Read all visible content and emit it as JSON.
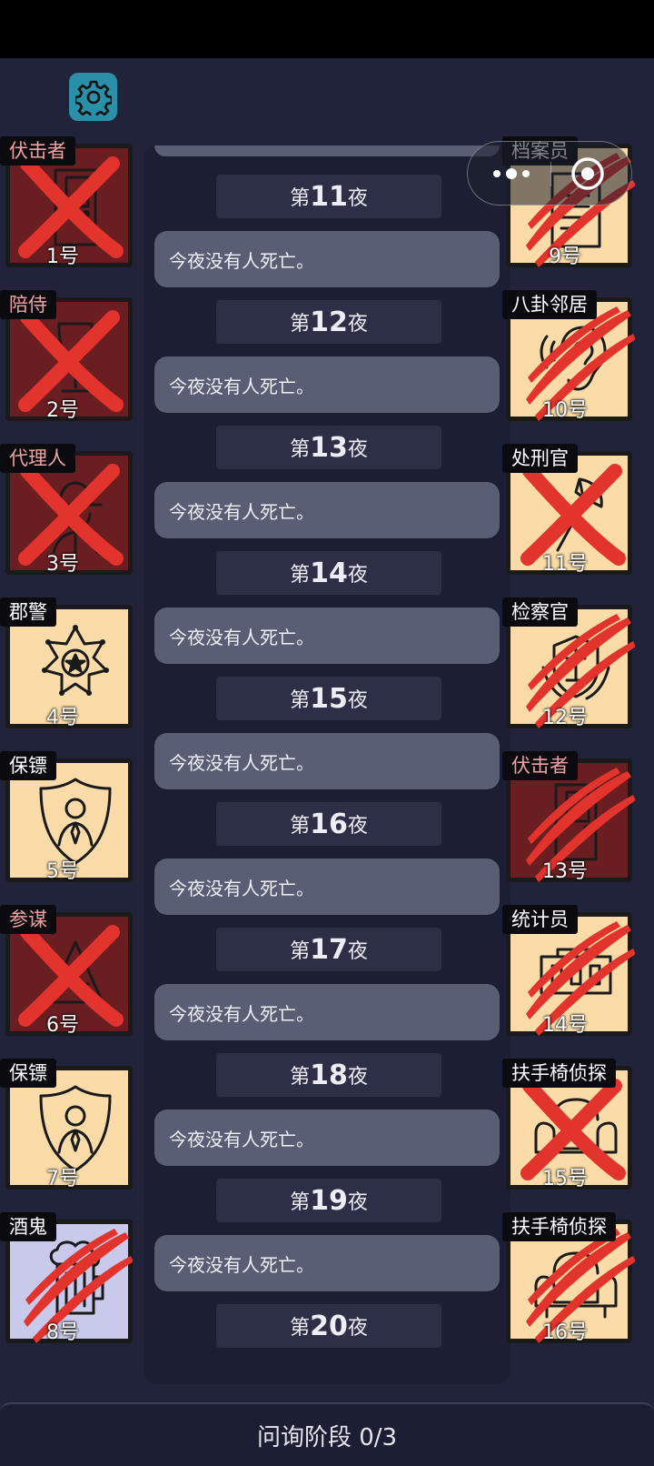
{
  "settings": {
    "icon": "gear-icon"
  },
  "capsule": {
    "more_icon": "more-dots-icon",
    "close_icon": "target-close-icon"
  },
  "log": {
    "entries": [
      {
        "night_prefix": "第",
        "night_num": "11",
        "night_suffix": "夜",
        "message": "今夜没有人死亡。"
      },
      {
        "night_prefix": "第",
        "night_num": "12",
        "night_suffix": "夜",
        "message": "今夜没有人死亡。"
      },
      {
        "night_prefix": "第",
        "night_num": "13",
        "night_suffix": "夜",
        "message": "今夜没有人死亡。"
      },
      {
        "night_prefix": "第",
        "night_num": "14",
        "night_suffix": "夜",
        "message": "今夜没有人死亡。"
      },
      {
        "night_prefix": "第",
        "night_num": "15",
        "night_suffix": "夜",
        "message": "今夜没有人死亡。"
      },
      {
        "night_prefix": "第",
        "night_num": "16",
        "night_suffix": "夜",
        "message": "今夜没有人死亡。"
      },
      {
        "night_prefix": "第",
        "night_num": "17",
        "night_suffix": "夜",
        "message": "今夜没有人死亡。"
      },
      {
        "night_prefix": "第",
        "night_num": "18",
        "night_suffix": "夜",
        "message": "今夜没有人死亡。"
      },
      {
        "night_prefix": "第",
        "night_num": "19",
        "night_suffix": "夜",
        "message": "今夜没有人死亡。"
      },
      {
        "night_prefix": "第",
        "night_num": "20",
        "night_suffix": "夜"
      }
    ]
  },
  "players_left": [
    {
      "role": "伏击者",
      "number": "1号",
      "role_color": "#f0a3a3",
      "status": "killed",
      "icon": "door-icon"
    },
    {
      "role": "陪侍",
      "number": "2号",
      "role_color": "#f0a3a3",
      "status": "killed",
      "icon": "wine-glass-icon"
    },
    {
      "role": "代理人",
      "number": "3号",
      "role_color": "#f0a3a3",
      "status": "killed",
      "icon": "agent-hat-icon"
    },
    {
      "role": "郡警",
      "number": "4号",
      "role_color": "#ffffff",
      "status": "alive",
      "icon": "sheriff-badge-icon"
    },
    {
      "role": "保镖",
      "number": "5号",
      "role_color": "#ffffff",
      "status": "alive",
      "icon": "bodyguard-shield-icon"
    },
    {
      "role": "参谋",
      "number": "6号",
      "role_color": "#f0a3a3",
      "status": "killed",
      "icon": "advisor-icon"
    },
    {
      "role": "保镖",
      "number": "7号",
      "role_color": "#ffffff",
      "status": "alive",
      "icon": "bodyguard-shield-icon"
    },
    {
      "role": "酒鬼",
      "number": "8号",
      "role_color": "#ffffff",
      "status": "clawed",
      "icon": "drunk-icon"
    }
  ],
  "players_right": [
    {
      "role": "档案员",
      "number": "9号",
      "role_color": "#ffffff",
      "status": "clawed",
      "icon": "archive-icon"
    },
    {
      "role": "八卦邻居",
      "number": "10号",
      "role_color": "#ffffff",
      "status": "clawed",
      "icon": "gossip-ear-icon"
    },
    {
      "role": "处刑官",
      "number": "11号",
      "role_color": "#ffffff",
      "status": "killed",
      "icon": "axe-icon"
    },
    {
      "role": "检察官",
      "number": "12号",
      "role_color": "#ffffff",
      "status": "clawed",
      "icon": "prosecutor-emblem-icon"
    },
    {
      "role": "伏击者",
      "number": "13号",
      "role_color": "#f0a3a3",
      "status": "clawed",
      "icon": "door-icon"
    },
    {
      "role": "统计员",
      "number": "14号",
      "role_color": "#ffffff",
      "status": "clawed",
      "icon": "counter-icon"
    },
    {
      "role": "扶手椅侦探",
      "number": "15号",
      "role_color": "#ffffff",
      "status": "killed",
      "icon": "armchair-icon"
    },
    {
      "role": "扶手椅侦探",
      "number": "16号",
      "role_color": "#ffffff",
      "status": "clawed",
      "icon": "armchair-icon"
    }
  ],
  "bottom_bar": {
    "label": "问询阶段 0/3"
  },
  "colors": {
    "background": "#20233a",
    "card_alive": "#fbdca8",
    "card_evil": "#6a1e22",
    "mark_red": "#e2332c",
    "settings_teal": "#2a8fa8"
  }
}
